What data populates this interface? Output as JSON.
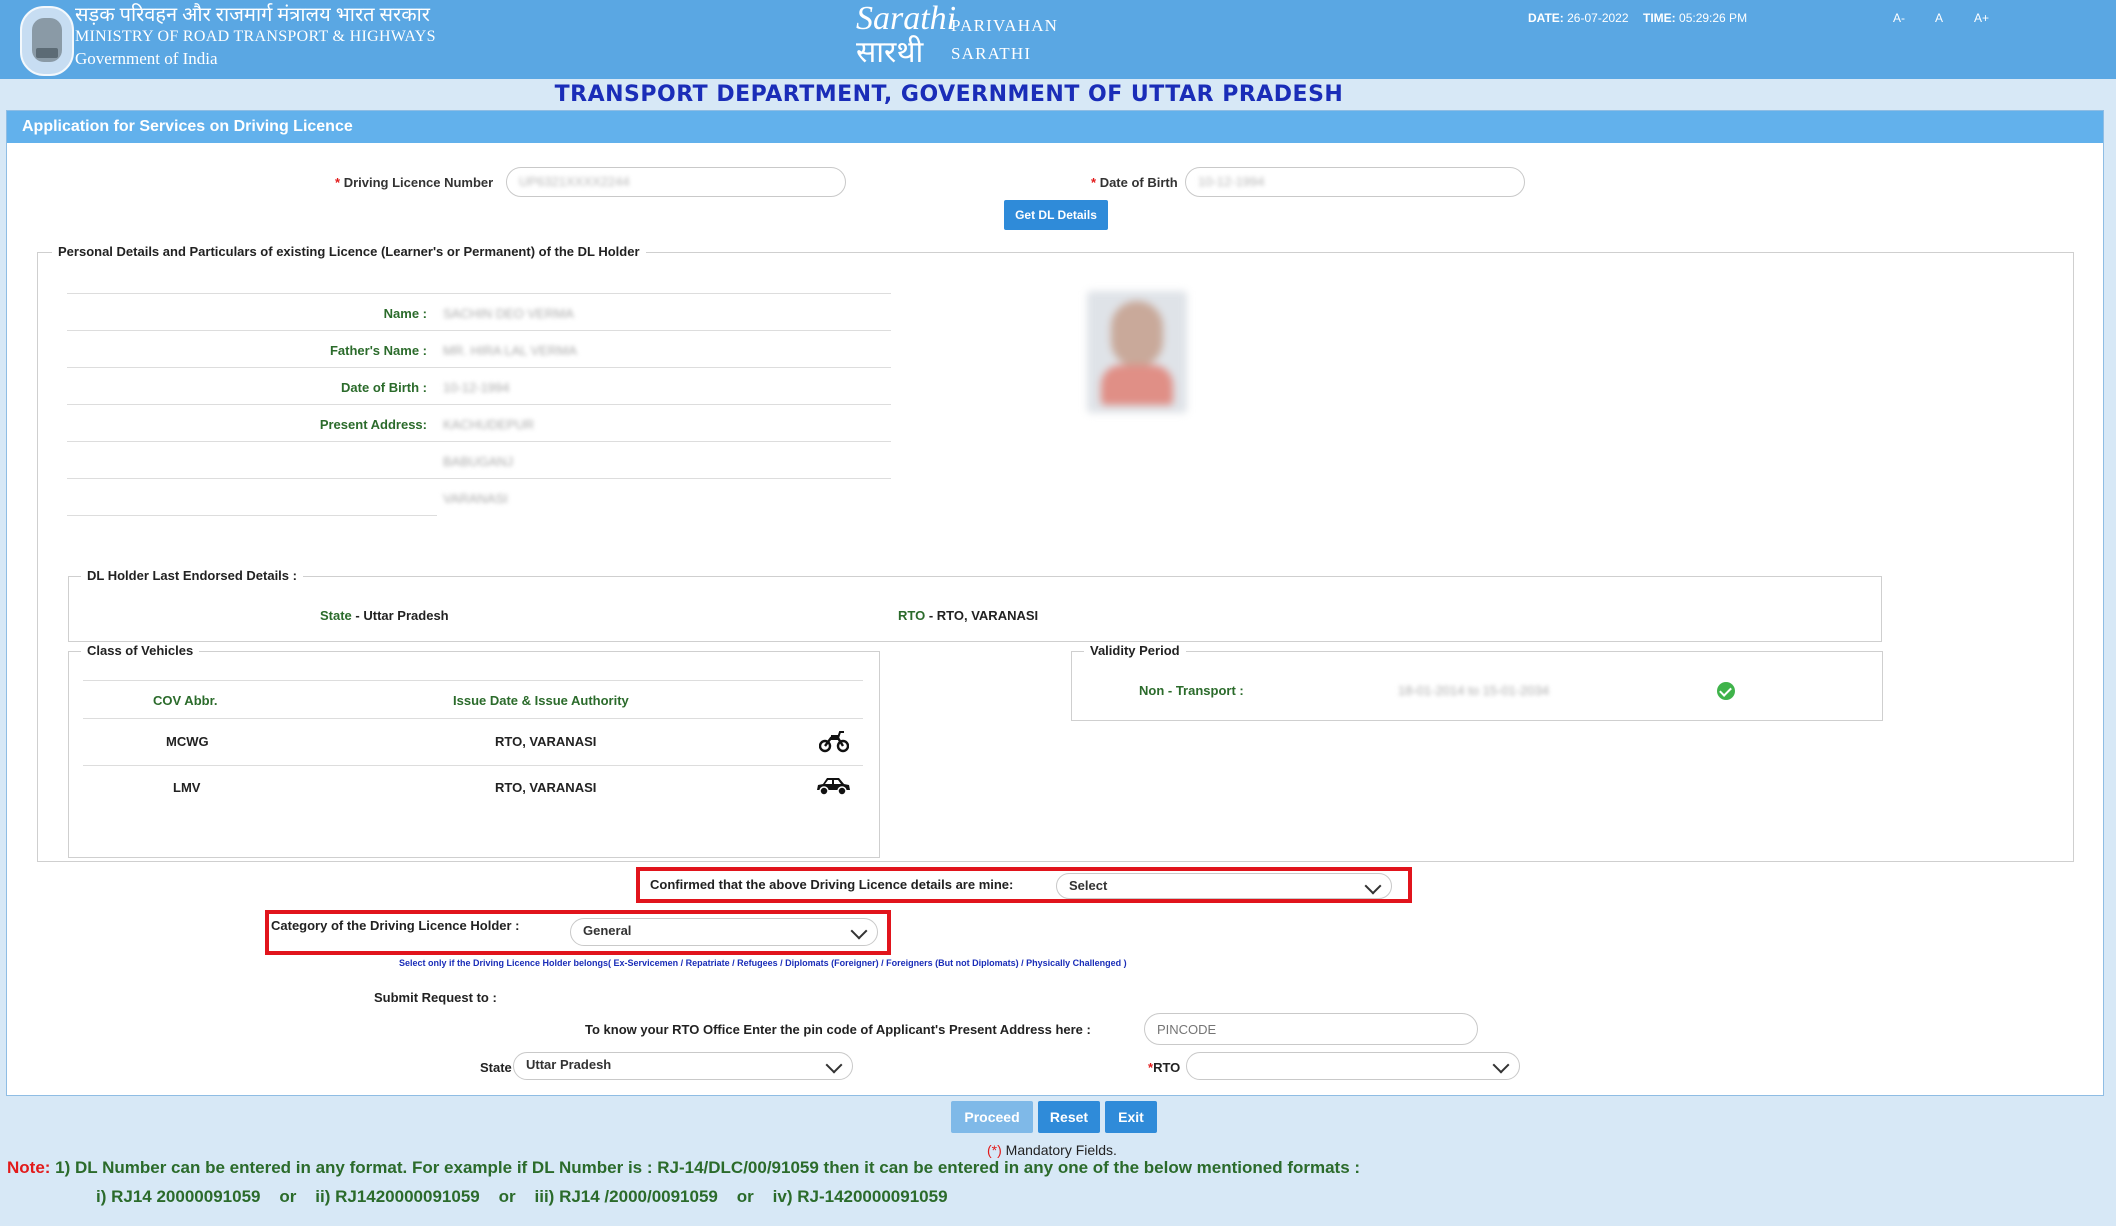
{
  "header": {
    "ministry_hindi": "सड़क परिवहन और राजमार्ग मंत्रालय भारत सरकार",
    "ministry_english": "MINISTRY OF ROAD TRANSPORT & HIGHWAYS",
    "government": "Government of India",
    "logo_script": "Sarathi",
    "logo_hindi": "सारथी",
    "logo_text_1": "PARIVAHAN",
    "logo_text_2": "SARATHI",
    "date_label": "DATE:",
    "date_value": "26-07-2022",
    "time_label": "TIME:",
    "time_value": "05:29:26 PM",
    "font_small": "A-",
    "font_normal": "A",
    "font_large": "A+"
  },
  "dept_title": "TRANSPORT DEPARTMENT, GOVERNMENT OF UTTAR PRADESH",
  "panel_title": "Application for Services on Driving Licence",
  "form": {
    "dl_label": "Driving Licence Number",
    "dl_value": "UP6321XXXX2244",
    "dob_label": "Date of Birth",
    "dob_value": "10-12-1994",
    "get_btn": "Get DL Details",
    "required_mark": "*"
  },
  "personal": {
    "legend": "Personal Details and Particulars of existing Licence (Learner's or Permanent) of the DL Holder",
    "name_label": "Name :",
    "name_value": "SACHIN DEO VERMA",
    "father_label": "Father's Name :",
    "father_value": "MR. HIRA LAL VERMA",
    "dob_label": "Date of Birth :",
    "dob_value": "10-12-1994",
    "address_label": "Present Address:",
    "address_1": "KACHUDEPUR",
    "address_2": "BABUGANJ",
    "address_3": "VARANASI"
  },
  "endorsed": {
    "legend": "DL Holder Last Endorsed Details :",
    "state_label": "State",
    "state_value": "- Uttar Pradesh",
    "rto_label": "RTO",
    "rto_value": "- RTO, VARANASI"
  },
  "cov": {
    "legend": "Class of Vehicles",
    "col1": "COV Abbr.",
    "col2": "Issue Date & Issue Authority",
    "rows": [
      {
        "abbr": "MCWG",
        "authority": "RTO, VARANASI"
      },
      {
        "abbr": "LMV",
        "authority": "RTO, VARANASI"
      }
    ]
  },
  "validity": {
    "legend": "Validity Period",
    "label": "Non - Transport :",
    "value": "18-01-2014 to 15-01-2034"
  },
  "confirm": {
    "label": "Confirmed that the above Driving Licence details are mine:",
    "value": "Select"
  },
  "category": {
    "label": "Category of the Driving Licence Holder :",
    "value": "General",
    "hint": "Select only if the Driving Licence Holder belongs( Ex-Servicemen / Repatriate / Refugees / Diplomats (Foreigner) / Foreigners (But not Diplomats) / Physically Challenged )"
  },
  "submit": {
    "label": "Submit Request to :",
    "pincode_label": "To know your RTO Office Enter the pin code of Applicant's Present Address here :",
    "pincode_placeholder": "PINCODE",
    "state_label": "State",
    "state_value": "Uttar Pradesh",
    "rto_label": "RTO",
    "rto_value": ""
  },
  "buttons": {
    "proceed": "Proceed",
    "reset": "Reset",
    "exit": "Exit"
  },
  "footer": {
    "mandatory_mark": "(*)",
    "mandatory_text": " Mandatory Fields.",
    "note_label": "Note:",
    "note_line1": " 1) DL Number can be entered in any format. For example if DL Number is : RJ-14/DLC/00/91059 then it can be entered in any one of the below mentioned formats :",
    "note_line2": "i) RJ14 20000091059    or    ii) RJ1420000091059    or    iii) RJ14 /2000/0091059    or    iv) RJ-1420000091059"
  },
  "colors": {
    "header_bg": "#5aa7e3",
    "panel_head": "#62b1ec",
    "title_blue": "#1a2db8",
    "green_label": "#2b6b2b",
    "highlight_red": "#e1141c"
  }
}
